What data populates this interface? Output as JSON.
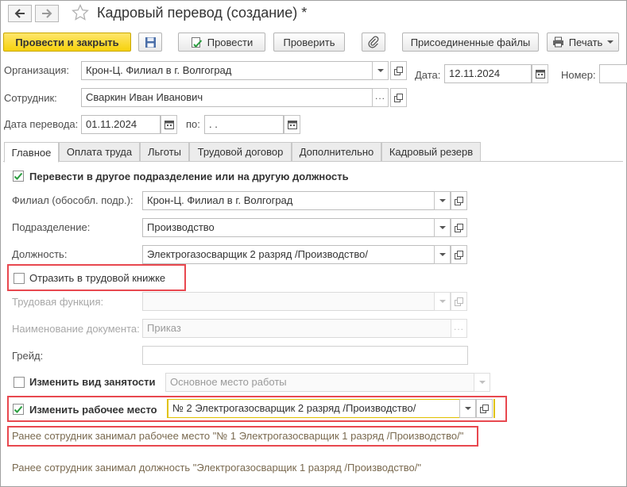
{
  "header": {
    "title": "Кадровый перевод (создание) *"
  },
  "toolbar": {
    "post_close": "Провести и закрыть",
    "post": "Провести",
    "check": "Проверить",
    "attached_files": "Присоединенные файлы",
    "print": "Печать"
  },
  "form": {
    "organization": {
      "label": "Организация:",
      "value": "Крон-Ц. Филиал в г. Волгоград"
    },
    "date": {
      "label": "Дата:",
      "value": "12.11.2024"
    },
    "number": {
      "label": "Номер:",
      "value": ""
    },
    "employee": {
      "label": "Сотрудник:",
      "value": "Сваркин Иван Иванович"
    },
    "transfer_date": {
      "label": "Дата перевода:",
      "value": "01.11.2024"
    },
    "to_date": {
      "label": "по:",
      "value": " .  ."
    }
  },
  "tabs": [
    {
      "label": "Главное",
      "active": true
    },
    {
      "label": "Оплата труда",
      "active": false
    },
    {
      "label": "Льготы",
      "active": false
    },
    {
      "label": "Трудовой договор",
      "active": false
    },
    {
      "label": "Дополнительно",
      "active": false
    },
    {
      "label": "Кадровый резерв",
      "active": false
    }
  ],
  "main": {
    "transfer_checkbox": {
      "label": "Перевести в другое подразделение или на другую должность",
      "checked": true
    },
    "branch": {
      "label": "Филиал (обособл. подр.):",
      "value": "Крон-Ц. Филиал в г. Волгоград"
    },
    "department": {
      "label": "Подразделение:",
      "value": "Производство"
    },
    "position": {
      "label": "Должность:",
      "value": "Электрогазосварщик 2 разряд /Производство/"
    },
    "work_book_checkbox": {
      "label": "Отразить в трудовой книжке",
      "checked": false
    },
    "labor_function": {
      "label": "Трудовая функция:",
      "value": ""
    },
    "doc_name": {
      "label": "Наименование документа:",
      "value": "Приказ"
    },
    "grade": {
      "label": "Грейд:",
      "value": ""
    },
    "employment_type_checkbox": {
      "label": "Изменить вид занятости",
      "checked": false
    },
    "employment_type": {
      "value": "Основное место работы"
    },
    "workplace_checkbox": {
      "label": "Изменить рабочее место",
      "checked": true
    },
    "workplace": {
      "value": "№ 2 Электрогазосварщик 2 разряд /Производство/"
    },
    "prev_workplace_note": "Ранее сотрудник занимал рабочее место \"№ 1 Электрогазосварщик 1 разряд /Производство/\"",
    "prev_position_note": "Ранее сотрудник занимал должность \"Электрогазосварщик 1 разряд /Производство/\""
  },
  "colors": {
    "primary_button": "#f6d20c",
    "highlight": "#e8484f",
    "check": "#2a9d3f"
  },
  "icons": [
    "back-arrow-icon",
    "forward-arrow-icon",
    "favorite-star-icon",
    "save-icon",
    "post-document-icon",
    "paperclip-icon",
    "printer-icon",
    "calendar-icon",
    "dropdown-arrow-icon",
    "open-form-icon",
    "select-dots-icon",
    "checkmark-icon"
  ]
}
